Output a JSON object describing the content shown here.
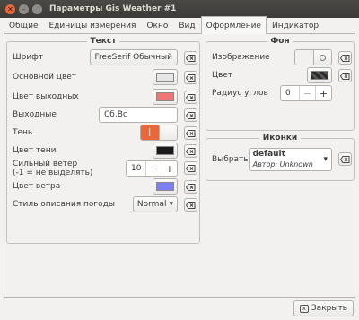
{
  "window": {
    "title": "Параметры Gis Weather #1"
  },
  "tabs": [
    "Общие",
    "Единицы измерения",
    "Окно",
    "Вид",
    "Оформление",
    "Индикатор"
  ],
  "text_group": {
    "title": "Текст",
    "font_label": "Шрифт",
    "font_value": "FreeSerif Обычный",
    "main_color_label": "Основной цвет",
    "main_color": "#e6e6e6",
    "holiday_color_label": "Цвет выходных",
    "holiday_color": "#f07575",
    "weekends_label": "Выходные",
    "weekends_value": "Сб,Вс",
    "shadow_label": "Тень",
    "shadow_on": true,
    "shadow_color_label": "Цвет тени",
    "shadow_color": "#1a1a1a",
    "strong_wind_label_1": "Сильный ветер",
    "strong_wind_label_2": "(-1 = не выделять)",
    "strong_wind_value": "10",
    "wind_color_label": "Цвет ветра",
    "wind_color": "#7f7ff5",
    "weather_style_label": "Стиль описания погоды",
    "weather_style_value": "Normal"
  },
  "bg_group": {
    "title": "Фон",
    "image_label": "Изображение",
    "image_on": false,
    "color_label": "Цвет",
    "color": "#2a2a2a",
    "radius_label": "Радиус углов",
    "radius_value": "0"
  },
  "icons_group": {
    "title": "Иконки",
    "select_label": "Выбрать",
    "selected_name": "default",
    "selected_author": "Автор: Unknown"
  },
  "controls": {
    "plus": "+",
    "minus": "−",
    "dropdown_arrow": "▾",
    "close_label": "Закрыть",
    "close_icon": "x",
    "clear_icon": "clear-icon"
  }
}
